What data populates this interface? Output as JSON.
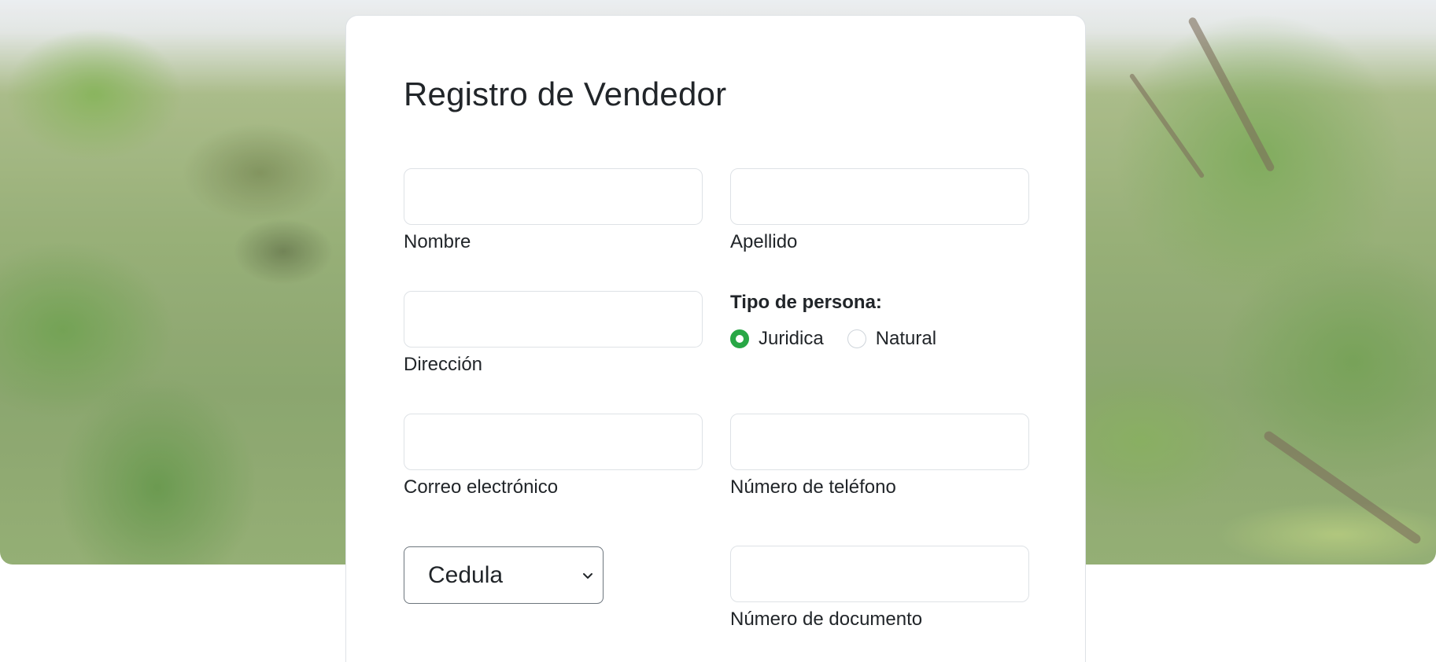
{
  "form": {
    "title": "Registro de Vendedor",
    "fields": {
      "nombre": {
        "label": "Nombre",
        "value": ""
      },
      "apellido": {
        "label": "Apellido",
        "value": ""
      },
      "direccion": {
        "label": "Dirección",
        "value": ""
      },
      "correo": {
        "label": "Correo electrónico",
        "value": ""
      },
      "telefono": {
        "label": "Número de teléfono",
        "value": ""
      },
      "documento": {
        "label": "Número de documento",
        "value": ""
      }
    },
    "tipo_persona": {
      "label": "Tipo de persona:",
      "options": [
        {
          "label": "Juridica",
          "checked": true
        },
        {
          "label": "Natural",
          "checked": false
        }
      ]
    },
    "tipo_documento": {
      "selected": "Cedula"
    }
  },
  "colors": {
    "accent": "#28a745",
    "border": "#dee2e6",
    "text": "#212529"
  },
  "icons": {
    "select_arrow": "chevron-down-icon"
  }
}
